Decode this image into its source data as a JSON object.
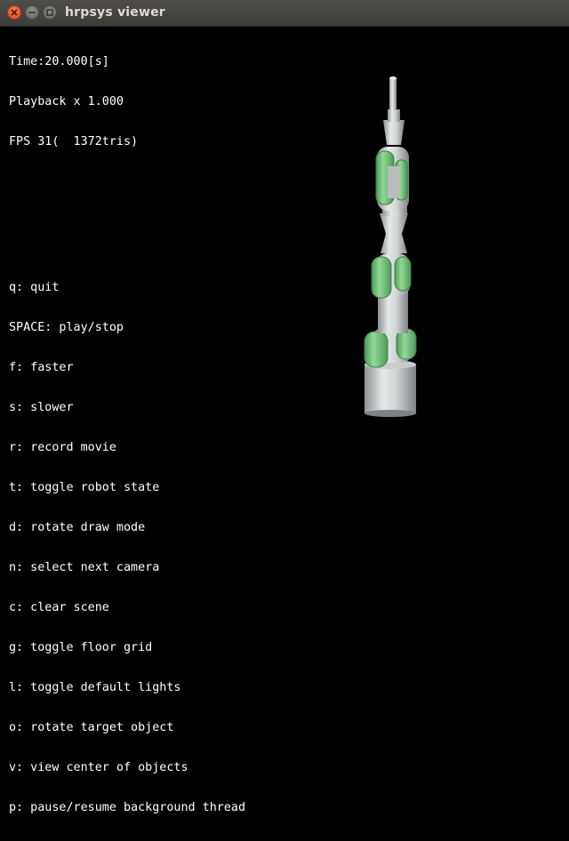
{
  "window": {
    "title": "hrpsys viewer"
  },
  "hud": {
    "time": "Time:20.000[s]",
    "playback": "Playback x 1.000",
    "fps": "FPS 31(  1372tris)"
  },
  "help": {
    "lines": [
      "q: quit",
      "SPACE: play/stop",
      "f: faster",
      "s: slower",
      "r: record movie",
      "t: toggle robot state",
      "d: rotate draw mode",
      "n: select next camera",
      "c: clear scene",
      "g: toggle floor grid",
      "l: toggle default lights",
      "o: rotate target object",
      "v: view center of objects",
      "p: pause/resume background thread"
    ]
  },
  "colors": {
    "link_gray": "#d8dadb",
    "joint_green": "#6fc17a",
    "background": "#000000"
  }
}
